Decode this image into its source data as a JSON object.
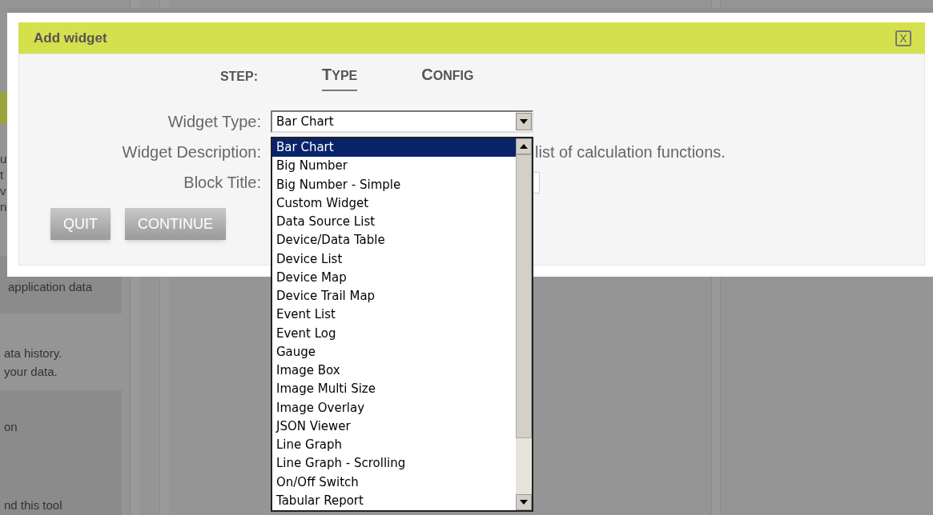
{
  "background": {
    "top_fragments": [
      "u",
      "t",
      "v",
      "n"
    ],
    "panel_fragments": [
      "application data"
    ],
    "middle_fragments": [
      "ata history.",
      "your data."
    ],
    "bottom_fragments": [
      "on",
      "nd this tool"
    ]
  },
  "dialog": {
    "title": "Add widget",
    "close": "X",
    "step_label": "STEP:",
    "steps": [
      {
        "label": "TYPE",
        "selected": true
      },
      {
        "label": "CONFIG",
        "selected": false
      }
    ],
    "fields": [
      {
        "label": "Widget Type:",
        "kind": "select",
        "value": "Bar Chart"
      },
      {
        "label": "Widget Description:",
        "kind": "text",
        "value": "list of calculation functions."
      },
      {
        "label": "Block Title:",
        "kind": "input"
      }
    ],
    "buttons": [
      "QUIT",
      "CONTINUE"
    ],
    "dropdown": {
      "options": [
        {
          "label": "Bar Chart",
          "selected": true
        },
        {
          "label": "Big Number",
          "selected": false
        },
        {
          "label": "Big Number - Simple",
          "selected": false
        },
        {
          "label": "Custom Widget",
          "selected": false
        },
        {
          "label": "Data Source List",
          "selected": false
        },
        {
          "label": "Device/Data Table",
          "selected": false
        },
        {
          "label": "Device List",
          "selected": false
        },
        {
          "label": "Device Map",
          "selected": false
        },
        {
          "label": "Device Trail Map",
          "selected": false
        },
        {
          "label": "Event List",
          "selected": false
        },
        {
          "label": "Event Log",
          "selected": false
        },
        {
          "label": "Gauge",
          "selected": false
        },
        {
          "label": "Image Box",
          "selected": false
        },
        {
          "label": "Image Multi Size",
          "selected": false
        },
        {
          "label": "Image Overlay",
          "selected": false
        },
        {
          "label": "JSON Viewer",
          "selected": false
        },
        {
          "label": "Line Graph",
          "selected": false
        },
        {
          "label": "Line Graph - Scrolling",
          "selected": false
        },
        {
          "label": "On/Off Switch",
          "selected": false
        },
        {
          "label": "Tabular Report",
          "selected": false
        }
      ]
    }
  }
}
